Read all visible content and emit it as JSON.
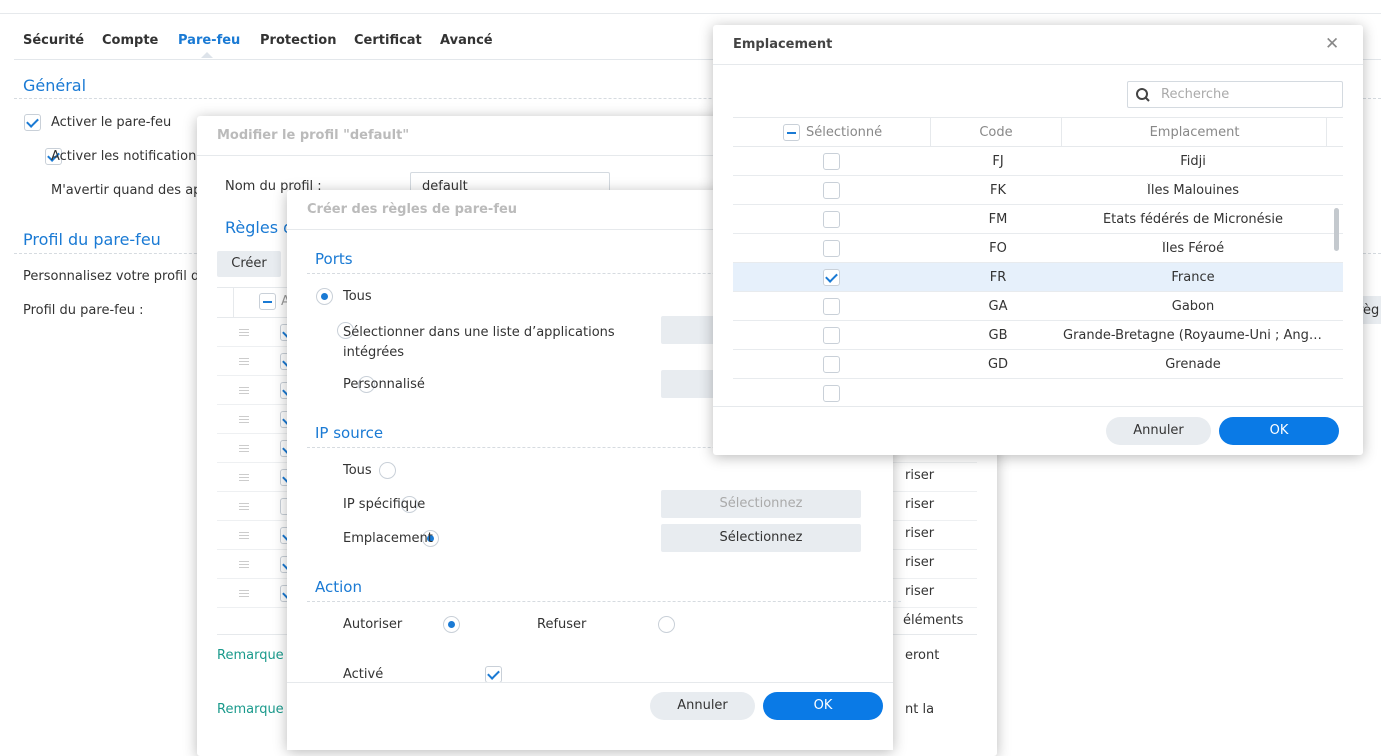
{
  "tabs": [
    "Sécurité",
    "Compte",
    "Pare-feu",
    "Protection",
    "Certificat",
    "Avancé"
  ],
  "general": {
    "title": "Général",
    "enable_firewall": "Activer le pare-feu",
    "enable_notifications": "Activer les notifications",
    "warn_text": "M'avertir quand des ap"
  },
  "profile": {
    "title": "Profil du pare-feu",
    "desc": "Personnalisez votre profil d",
    "label": "Profil du pare-feu :",
    "right_text": "règ"
  },
  "edit_dialog": {
    "title": "Modifier le profil \"default\"",
    "name_label": "Nom du profil :",
    "name_value": "default",
    "rules_title": "Règles d",
    "create": "Créer",
    "header_frag": "A",
    "action_cells": [
      "riser",
      "riser",
      "riser",
      "riser",
      "riser"
    ],
    "items_text": "éléments",
    "remark1": "Remarque",
    "remark1_tail": "eront",
    "remark2": "Remarque",
    "remark2_tail": "nt la",
    "checked": [
      true,
      true,
      true,
      true,
      true,
      true,
      false,
      true,
      true,
      true
    ]
  },
  "create_dialog": {
    "title": "Créer des règles de pare-feu",
    "ports": {
      "title": "Ports",
      "all": "Tous",
      "list": "Sélectionner dans une liste d’applications intégrées",
      "custom": "Personnalisé"
    },
    "source": {
      "title": "IP source",
      "all": "Tous",
      "specific": "IP spécifique",
      "location": "Emplacement",
      "select_disabled": "Sélectionnez",
      "select": "Sélectionnez"
    },
    "action": {
      "title": "Action",
      "allow": "Autoriser",
      "deny": "Refuser"
    },
    "enabled": "Activé",
    "cancel": "Annuler",
    "ok": "OK"
  },
  "location_dialog": {
    "title": "Emplacement",
    "search_placeholder": "Recherche",
    "columns": [
      "Sélectionné",
      "Code",
      "Emplacement"
    ],
    "rows": [
      {
        "code": "FJ",
        "name": "Fidji",
        "checked": false
      },
      {
        "code": "FK",
        "name": "Îles Malouines",
        "checked": false
      },
      {
        "code": "FM",
        "name": "États fédérés de Micronésie",
        "checked": false
      },
      {
        "code": "FO",
        "name": "Îles Féroé",
        "checked": false
      },
      {
        "code": "FR",
        "name": "France",
        "checked": true
      },
      {
        "code": "GA",
        "name": "Gabon",
        "checked": false
      },
      {
        "code": "GB",
        "name": "Grande-Bretagne (Royaume-Uni ; Angleterre)",
        "checked": false
      },
      {
        "code": "GD",
        "name": "Grenade",
        "checked": false
      }
    ],
    "cancel": "Annuler",
    "ok": "OK"
  }
}
